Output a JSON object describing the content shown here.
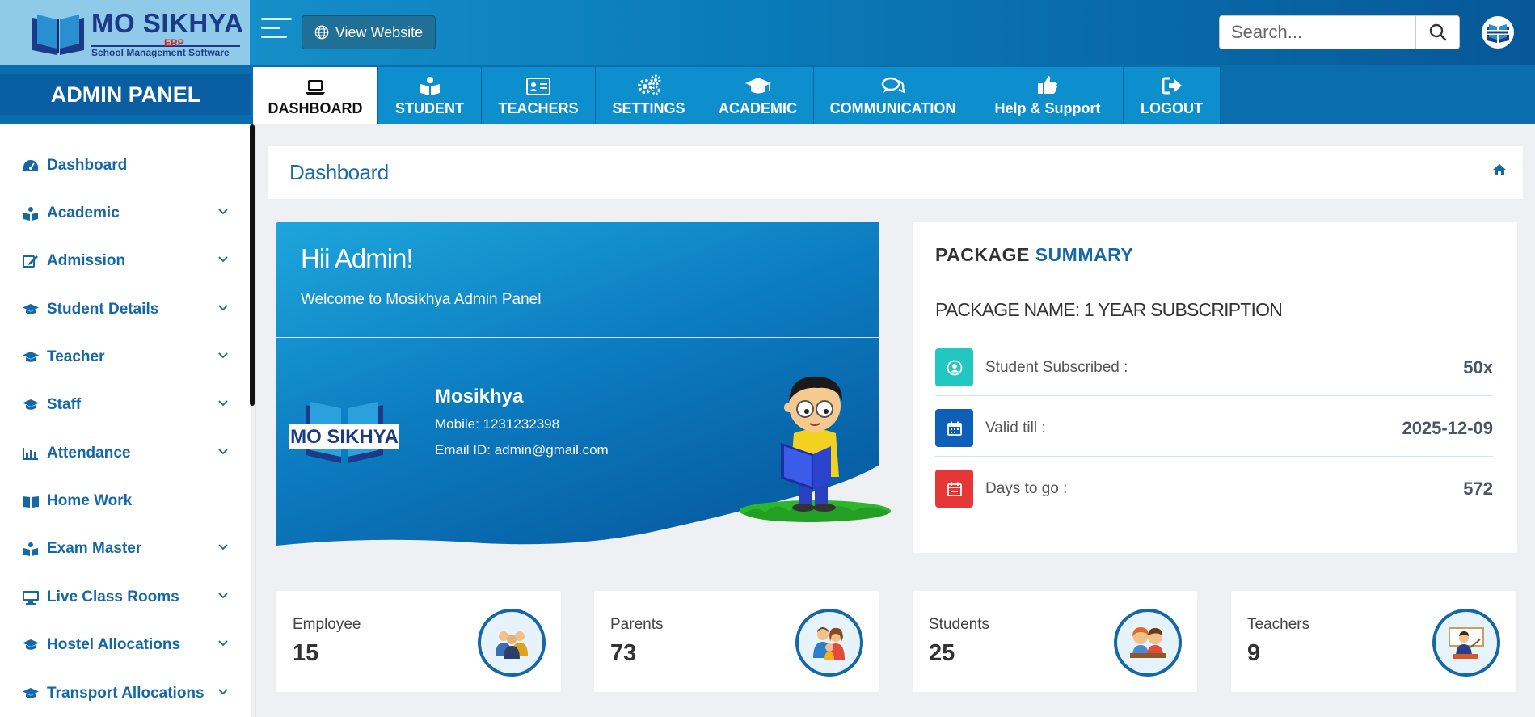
{
  "brand": {
    "name": "MO SIKHYA",
    "erp": "ERP",
    "tagline": "School Management Software"
  },
  "header": {
    "view_website_label": "View Website",
    "search_placeholder": "Search..."
  },
  "admin_panel_label": "ADMIN PANEL",
  "tabs": [
    {
      "label": "DASHBOARD",
      "icon": "laptop-icon",
      "active": true
    },
    {
      "label": "STUDENT",
      "icon": "reader-icon"
    },
    {
      "label": "TEACHERS",
      "icon": "id-card-icon"
    },
    {
      "label": "SETTINGS",
      "icon": "cogs-icon"
    },
    {
      "label": "ACADEMIC",
      "icon": "graduation-cap-icon"
    },
    {
      "label": "COMMUNICATION",
      "icon": "comments-icon"
    },
    {
      "label": "Help & Support",
      "icon": "thumbs-up-icon"
    },
    {
      "label": "LOGOUT",
      "icon": "sign-out-icon"
    }
  ],
  "sidebar": {
    "items": [
      {
        "label": "Dashboard",
        "icon": "dashboard-icon",
        "has_submenu": false
      },
      {
        "label": "Academic",
        "icon": "reader-icon",
        "has_submenu": true
      },
      {
        "label": "Admission",
        "icon": "edit-icon",
        "has_submenu": true
      },
      {
        "label": "Student Details",
        "icon": "graduation-cap-icon",
        "has_submenu": true
      },
      {
        "label": "Teacher",
        "icon": "graduation-cap-icon",
        "has_submenu": true
      },
      {
        "label": "Staff",
        "icon": "graduation-cap-icon",
        "has_submenu": true
      },
      {
        "label": "Attendance",
        "icon": "bar-chart-icon",
        "has_submenu": true
      },
      {
        "label": "Home Work",
        "icon": "book-open-icon",
        "has_submenu": false
      },
      {
        "label": "Exam Master",
        "icon": "reader-icon",
        "has_submenu": true
      },
      {
        "label": "Live Class Rooms",
        "icon": "monitor-icon",
        "has_submenu": true
      },
      {
        "label": "Hostel Allocations",
        "icon": "graduation-cap-icon",
        "has_submenu": true
      },
      {
        "label": "Transport Allocations",
        "icon": "graduation-cap-icon",
        "has_submenu": true
      }
    ]
  },
  "page": {
    "title": "Dashboard"
  },
  "welcome": {
    "greeting": "Hii Admin!",
    "message": "Welcome to Mosikhya Admin Panel",
    "org_logo_text": "MO SIKHYA",
    "org_name": "Mosikhya",
    "mobile": "Mobile: 1231232398",
    "email": "Email ID: admin@gmail.com"
  },
  "package": {
    "title_part1": "PACKAGE",
    "title_part2": "SUMMARY",
    "name_line": "PACKAGE NAME: 1 YEAR SUBSCRIPTION",
    "rows": [
      {
        "label": "Student Subscribed :",
        "value": "50x",
        "icon": "user-circle-icon",
        "color": "#22c7c0"
      },
      {
        "label": "Valid till :",
        "value": "2025-12-09",
        "icon": "calendar-icon",
        "color": "#0d5fb7"
      },
      {
        "label": "Days to go :",
        "value": "572",
        "icon": "calendar-icon",
        "color": "#e63636"
      }
    ]
  },
  "stats": [
    {
      "label": "Employee",
      "value": "15",
      "icon": "employees-icon"
    },
    {
      "label": "Parents",
      "value": "73",
      "icon": "parents-icon"
    },
    {
      "label": "Students",
      "value": "25",
      "icon": "students-icon"
    },
    {
      "label": "Teachers",
      "value": "9",
      "icon": "teacher-icon"
    }
  ],
  "colors": {
    "primary": "#1567a6",
    "header_dark": "#075898",
    "tab_blue": "#0e8fcd"
  }
}
